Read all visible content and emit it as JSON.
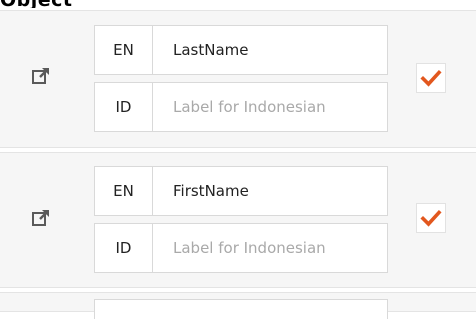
{
  "top_label": "Object",
  "rows": [
    {
      "id": "lastname",
      "icon": "external-link-icon",
      "checked": true,
      "fields": [
        {
          "lang": "EN",
          "value": "LastName",
          "placeholder": ""
        },
        {
          "lang": "ID",
          "value": "",
          "placeholder": "Label for Indonesian"
        }
      ]
    },
    {
      "id": "firstname",
      "icon": "external-link-icon",
      "checked": true,
      "fields": [
        {
          "lang": "EN",
          "value": "FirstName",
          "placeholder": ""
        },
        {
          "lang": "ID",
          "value": "",
          "placeholder": "Label for Indonesian"
        }
      ]
    }
  ],
  "colors": {
    "check_accent": "#e2571e",
    "row_background": "#f6f6f6",
    "placeholder_text": "#a9a9a9"
  }
}
